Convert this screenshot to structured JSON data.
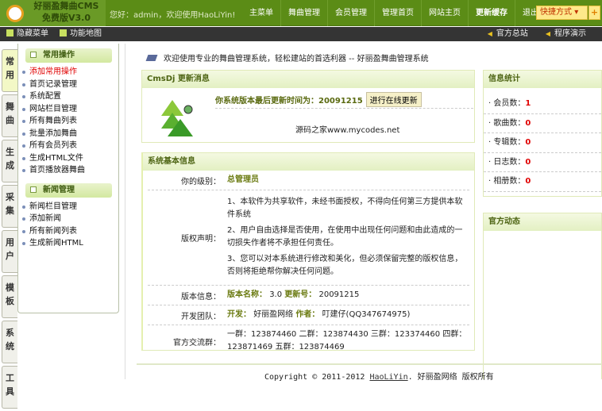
{
  "header": {
    "logo_line1": "好丽盈舞曲CMS",
    "logo_line2": "免费版V3.0",
    "greeting": "您好：admin，欢迎使用HaoLiYin!",
    "nav": [
      "主菜单",
      "舞曲管理",
      "会员管理",
      "管理首页",
      "网站主页",
      "更新缓存",
      "退出"
    ],
    "quick": "快捷方式",
    "plus": "+"
  },
  "subbar": {
    "left": [
      "隐藏菜单",
      "功能地图"
    ],
    "right": [
      "官方总站",
      "程序演示"
    ]
  },
  "tabs": [
    "常用",
    "舞曲",
    "生成",
    "采集",
    "用户",
    "模板",
    "系统",
    "工具"
  ],
  "sidebar": {
    "groups": [
      {
        "title": "常用操作",
        "items": [
          "添加常用操作",
          "首页记录管理",
          "系统配置",
          "网站栏目管理",
          "所有舞曲列表",
          "批量添加舞曲",
          "所有会员列表",
          "生成HTML文件",
          "首页播放器舞曲"
        ]
      },
      {
        "title": "新闻管理",
        "items": [
          "新闻栏目管理",
          "添加新闻",
          "所有新闻列表",
          "生成新闻HTML"
        ]
      }
    ]
  },
  "welcome": "欢迎使用专业的舞曲管理系统，轻松建站的首选利器 -- 好丽盈舞曲管理系统",
  "update": {
    "title": "CmsDj 更新消息",
    "line": "你系统版本最后更新时间为：20091215",
    "button": "进行在线更新",
    "source": "源码之家www.mycodes.net"
  },
  "sysinfo": {
    "title": "系统基本信息",
    "level_label": "你的级别：",
    "level": "总管理员",
    "copyright_label": "版权声明：",
    "copyright": [
      "1、本软件为共享软件，未经书面授权，不得向任何第三方提供本软件系统",
      "2、用户自由选择是否使用，在使用中出现任何问题和由此造成的一切损失作者将不承担任何责任。",
      "3、您可以对本系统进行修改和美化，但必须保留完整的版权信息，否则将拒绝帮你解决任何问题。"
    ],
    "version_label": "版本信息：",
    "version_name_label": "版本名称：",
    "version_name": "3.0",
    "update_no_label": "更新号：",
    "update_no": "20091215",
    "team_label": "开发团队：",
    "dev_label": "开发：",
    "dev": "好丽盈网络",
    "author_label": "作者：",
    "author": "叮建仔(QQ347674975)",
    "qq_label": "官方交流群：",
    "qq": "一群：123874460 二群：123874430 三群：123374460 四群：123871469 五群：123874469"
  },
  "stats": {
    "title": "信息统计",
    "items": [
      {
        "label": "会员数：",
        "value": "1"
      },
      {
        "label": "歌曲数：",
        "value": "0"
      },
      {
        "label": "专辑数：",
        "value": "0"
      },
      {
        "label": "日志数：",
        "value": "0"
      },
      {
        "label": "相册数：",
        "value": "0"
      }
    ]
  },
  "news": {
    "title": "官方动态"
  },
  "footer": {
    "pre": "Copyright © 2011-2012 ",
    "link": "HaoLiYin",
    "post": ". 好丽盈网络 版权所有"
  }
}
